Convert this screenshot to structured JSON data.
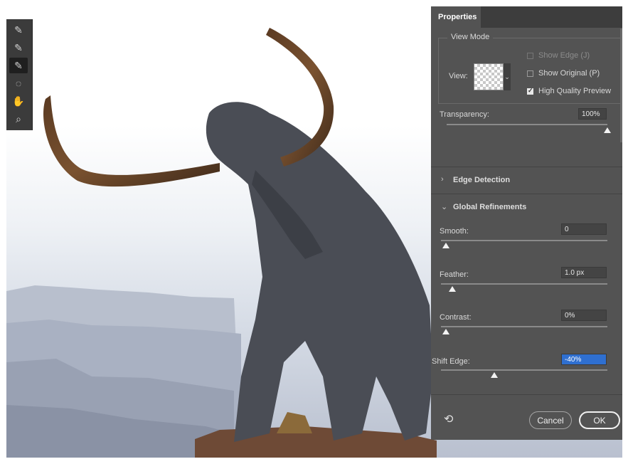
{
  "panel": {
    "tab": "Properties",
    "view_mode": {
      "legend": "View Mode",
      "view_label": "View:",
      "show_edge": "Show Edge (J)",
      "show_original": "Show Original (P)",
      "high_quality_preview": "High Quality Preview",
      "show_edge_checked": false,
      "show_original_checked": false,
      "high_quality_checked": true
    },
    "transparency": {
      "label": "Transparency:",
      "value": "100%"
    },
    "edge_detection": {
      "title": "Edge Detection",
      "chevron": "›"
    },
    "global_refinements": {
      "title": "Global Refinements",
      "chevron": "⌄",
      "smooth": {
        "label": "Smooth:",
        "value": "0"
      },
      "feather": {
        "label": "Feather:",
        "value": "1.0 px"
      },
      "contrast": {
        "label": "Contrast:",
        "value": "0%"
      },
      "shift_edge": {
        "label": "Shift Edge:",
        "value": "-40%"
      }
    },
    "buttons": {
      "cancel": "Cancel",
      "ok": "OK",
      "reset_icon": "⟲"
    }
  },
  "tools": [
    {
      "name": "quick-selection-tool-icon",
      "glyph": "✎"
    },
    {
      "name": "refine-edge-brush-icon",
      "glyph": "✎"
    },
    {
      "name": "brush-tool-icon",
      "glyph": "✎"
    },
    {
      "name": "lasso-tool-icon",
      "glyph": "◌"
    },
    {
      "name": "hand-tool-icon",
      "glyph": "✋"
    },
    {
      "name": "zoom-tool-icon",
      "glyph": "⌕"
    }
  ]
}
